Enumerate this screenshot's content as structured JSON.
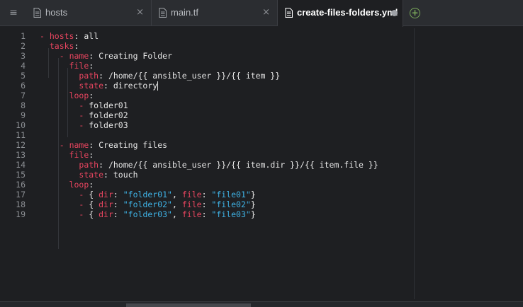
{
  "tabs": [
    {
      "label": "hosts",
      "state": "close"
    },
    {
      "label": "main.tf",
      "state": "close"
    },
    {
      "label": "create-files-folders.yml",
      "state": "modified",
      "active": true
    }
  ],
  "tab_close_glyph": "×",
  "menu_glyph": "≡",
  "add_glyph": "+",
  "icons": {
    "menu": "hamburger-menu-icon",
    "file": "file-icon",
    "add": "add-tab-icon",
    "modified": "modified-dot-icon"
  },
  "colors": {
    "key": "#e8455f",
    "string": "#3fb4e8",
    "text": "#e6e6e6",
    "add": "#7aa95a"
  },
  "editor": {
    "lines": [
      {
        "n": "1",
        "t": [
          [
            "dash",
            "- "
          ],
          [
            "key",
            "hosts"
          ],
          [
            "pun",
            ": "
          ],
          [
            "val",
            "all"
          ]
        ]
      },
      {
        "n": "2",
        "t": [
          [
            "pun",
            "  "
          ],
          [
            "key",
            "tasks"
          ],
          [
            "pun",
            ":"
          ]
        ]
      },
      {
        "n": "3",
        "t": [
          [
            "pun",
            "    "
          ],
          [
            "dash",
            "- "
          ],
          [
            "key",
            "name"
          ],
          [
            "pun",
            ": "
          ],
          [
            "val",
            "Creating Folder"
          ]
        ]
      },
      {
        "n": "4",
        "t": [
          [
            "pun",
            "      "
          ],
          [
            "key",
            "file"
          ],
          [
            "pun",
            ":"
          ]
        ]
      },
      {
        "n": "5",
        "t": [
          [
            "pun",
            "        "
          ],
          [
            "key",
            "path"
          ],
          [
            "pun",
            ": "
          ],
          [
            "val",
            "/home/{{ ansible_user }}/{{ item }}"
          ]
        ]
      },
      {
        "n": "6",
        "t": [
          [
            "pun",
            "        "
          ],
          [
            "key",
            "state"
          ],
          [
            "pun",
            ": "
          ],
          [
            "val",
            "directory"
          ]
        ],
        "cursor": true
      },
      {
        "n": "7",
        "t": [
          [
            "pun",
            "      "
          ],
          [
            "key",
            "loop"
          ],
          [
            "pun",
            ":"
          ]
        ]
      },
      {
        "n": "8",
        "t": [
          [
            "pun",
            "        "
          ],
          [
            "dash",
            "- "
          ],
          [
            "val",
            "folder01"
          ]
        ]
      },
      {
        "n": "9",
        "t": [
          [
            "pun",
            "        "
          ],
          [
            "dash",
            "- "
          ],
          [
            "val",
            "folder02"
          ]
        ]
      },
      {
        "n": "10",
        "t": [
          [
            "pun",
            "        "
          ],
          [
            "dash",
            "- "
          ],
          [
            "val",
            "folder03"
          ]
        ]
      },
      {
        "n": "11",
        "t": []
      },
      {
        "n": "12",
        "t": [
          [
            "pun",
            "    "
          ],
          [
            "dash",
            "- "
          ],
          [
            "key",
            "name"
          ],
          [
            "pun",
            ": "
          ],
          [
            "val",
            "Creating files"
          ]
        ]
      },
      {
        "n": "13",
        "t": [
          [
            "pun",
            "      "
          ],
          [
            "key",
            "file"
          ],
          [
            "pun",
            ":"
          ]
        ]
      },
      {
        "n": "14",
        "t": [
          [
            "pun",
            "        "
          ],
          [
            "key",
            "path"
          ],
          [
            "pun",
            ": "
          ],
          [
            "val",
            "/home/{{ ansible_user }}/{{ item.dir }}/{{ item.file }}"
          ]
        ]
      },
      {
        "n": "15",
        "t": [
          [
            "pun",
            "        "
          ],
          [
            "key",
            "state"
          ],
          [
            "pun",
            ": "
          ],
          [
            "val",
            "touch"
          ]
        ]
      },
      {
        "n": "16",
        "t": [
          [
            "pun",
            "      "
          ],
          [
            "key",
            "loop"
          ],
          [
            "pun",
            ":"
          ]
        ]
      },
      {
        "n": "17",
        "t": [
          [
            "pun",
            "        "
          ],
          [
            "dash",
            "- "
          ],
          [
            "pun",
            "{ "
          ],
          [
            "key",
            "dir"
          ],
          [
            "pun",
            ": "
          ],
          [
            "str",
            "\"folder01\""
          ],
          [
            "pun",
            ", "
          ],
          [
            "key",
            "file"
          ],
          [
            "pun",
            ": "
          ],
          [
            "str",
            "\"file01\""
          ],
          [
            "pun",
            "}"
          ]
        ]
      },
      {
        "n": "18",
        "t": [
          [
            "pun",
            "        "
          ],
          [
            "dash",
            "- "
          ],
          [
            "pun",
            "{ "
          ],
          [
            "key",
            "dir"
          ],
          [
            "pun",
            ": "
          ],
          [
            "str",
            "\"folder02\""
          ],
          [
            "pun",
            ", "
          ],
          [
            "key",
            "file"
          ],
          [
            "pun",
            ": "
          ],
          [
            "str",
            "\"file02\""
          ],
          [
            "pun",
            "}"
          ]
        ]
      },
      {
        "n": "19",
        "t": [
          [
            "pun",
            "        "
          ],
          [
            "dash",
            "- "
          ],
          [
            "pun",
            "{ "
          ],
          [
            "key",
            "dir"
          ],
          [
            "pun",
            ": "
          ],
          [
            "str",
            "\"folder03\""
          ],
          [
            "pun",
            ", "
          ],
          [
            "key",
            "file"
          ],
          [
            "pun",
            ": "
          ],
          [
            "str",
            "\"file03\""
          ],
          [
            "pun",
            "}"
          ]
        ]
      }
    ]
  }
}
